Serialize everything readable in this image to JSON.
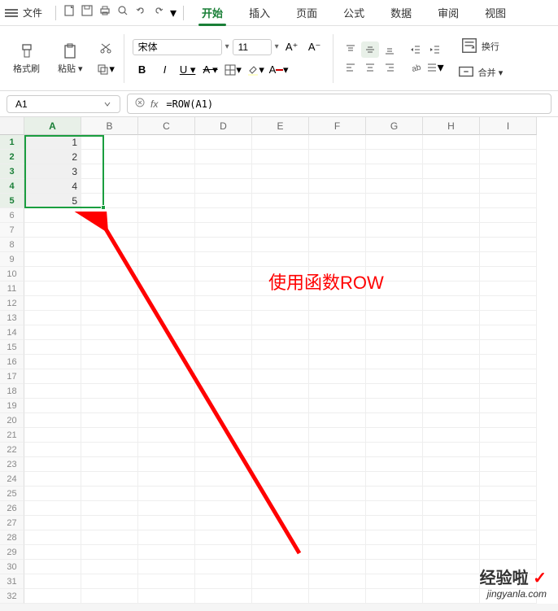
{
  "titlebar": {
    "file_label": "文件"
  },
  "tabs": [
    {
      "label": "开始",
      "active": true
    },
    {
      "label": "插入"
    },
    {
      "label": "页面"
    },
    {
      "label": "公式"
    },
    {
      "label": "数据"
    },
    {
      "label": "审阅"
    },
    {
      "label": "视图"
    }
  ],
  "ribbon": {
    "format_painter": "格式刷",
    "paste": "粘贴",
    "font_name": "宋体",
    "font_size": "11",
    "wrap_text": "换行",
    "merge_cells": "合并"
  },
  "formula_bar": {
    "name_box": "A1",
    "fx_label": "fx",
    "formula": "=ROW(A1)"
  },
  "columns": [
    "A",
    "B",
    "C",
    "D",
    "E",
    "F",
    "G",
    "H",
    "I"
  ],
  "row_count": 32,
  "selected_range": "A1:A5",
  "cell_data": {
    "A1": "1",
    "A2": "2",
    "A3": "3",
    "A4": "4",
    "A5": "5"
  },
  "annotation_text": "使用函数ROW",
  "watermark": {
    "brand": "经验啦",
    "url": "jingyanla.com"
  }
}
